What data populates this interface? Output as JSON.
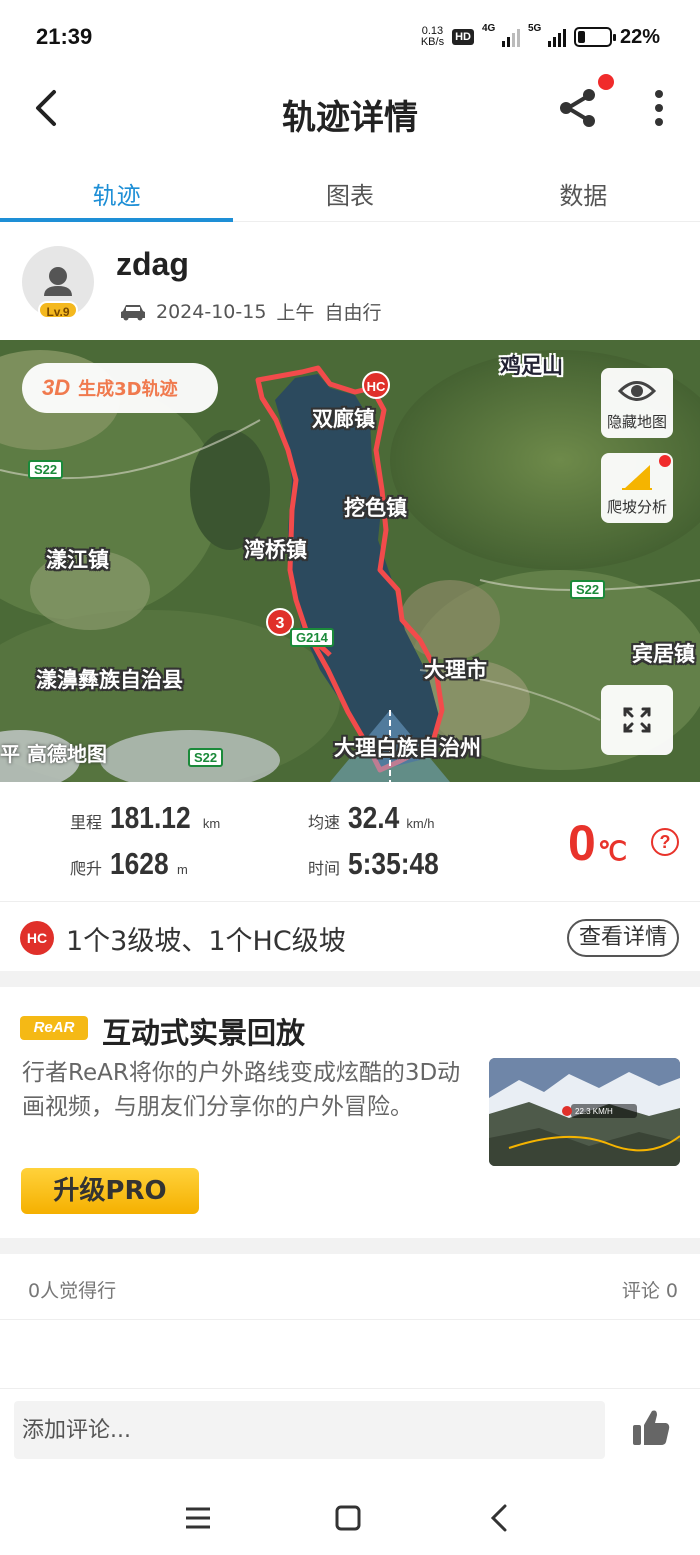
{
  "status_bar": {
    "time": "21:39",
    "net_speed_value": "0.13",
    "net_speed_unit": "KB/s",
    "hd_badge": "HD",
    "gen_4g": "4G",
    "gen_5g": "5G",
    "battery_level": 0.22,
    "battery_text": "22%"
  },
  "header": {
    "title": "轨迹详情"
  },
  "tabs": [
    {
      "label": "轨迹",
      "active": true
    },
    {
      "label": "图表",
      "active": false
    },
    {
      "label": "数据",
      "active": false
    }
  ],
  "user": {
    "name": "zdag",
    "level": "Lv.9",
    "date": "2024-10-15",
    "time_of_day": "上午",
    "activity": "自由行"
  },
  "map": {
    "gen3d_icon": "3D",
    "gen3d_label": "生成3D轨迹",
    "hide_map_label": "隐藏地图",
    "climb_analysis_label": "爬坡分析",
    "hc_marker": "HC",
    "cat3_marker": "3",
    "watermark": "平 高德地图",
    "place_labels": {
      "jizushan": "鸡足山",
      "shuangliao": "双廊镇",
      "wase": "挖色镇",
      "wanqiao": "湾桥镇",
      "yangjiang": "漾江镇",
      "yangbi": "漾濞彝族自治县",
      "dalishi": "大理市",
      "binju": "宾居镇",
      "dali_zhou": "大理白族自治州"
    },
    "roads": {
      "s22_a": "S22",
      "s22_b": "S22",
      "s22_c": "S22",
      "g214": "G214"
    }
  },
  "stats": {
    "distance_label": "里程",
    "distance_value": "181.12",
    "distance_unit": "km",
    "avg_speed_label": "均速",
    "avg_speed_value": "32.4",
    "avg_speed_unit": "km/h",
    "climb_label": "爬升",
    "climb_value": "1628",
    "climb_unit": "m",
    "duration_label": "时间",
    "duration_value": "5:35:48",
    "temperature_value": "0",
    "temperature_unit": "℃",
    "help_glyph": "?"
  },
  "climbs": {
    "icon_text": "HC",
    "summary": "1个3级坡、1个HC级坡",
    "detail_button": "查看详情"
  },
  "promo": {
    "logo": "ReAR",
    "title": "互动式实景回放",
    "description": "行者ReAR将你的户外路线变成炫酷的3D动画视频，与朋友们分享你的户外冒险。",
    "thumb_speed": "22.3 KM/H",
    "upgrade_button": "升级PRO"
  },
  "social": {
    "likes": "0人觉得行",
    "comments": "评论 0"
  },
  "comment_bar": {
    "placeholder": "添加评论..."
  },
  "colors": {
    "accent_blue": "#1e8fd6",
    "track_red": "#f24b4b",
    "temp_red": "#e8332b",
    "pro_yellow": "#f5b000"
  },
  "icons": {
    "back": "back-arrow-icon",
    "share": "share-icon",
    "more": "more-vertical-icon",
    "car": "car-icon",
    "eye": "eye-icon",
    "slope": "slope-chart-icon",
    "fullscreen": "fullscreen-icon",
    "thumbs_up": "thumbs-up-icon",
    "nav_menu": "menu-icon",
    "nav_home": "home-square-icon",
    "nav_back": "nav-back-icon"
  }
}
